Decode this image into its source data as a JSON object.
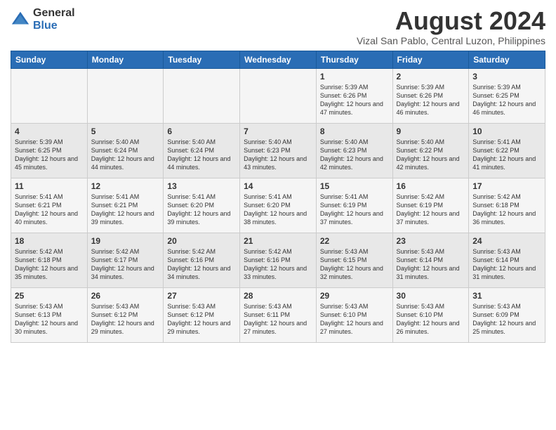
{
  "logo": {
    "general": "General",
    "blue": "Blue"
  },
  "title": {
    "month_year": "August 2024",
    "location": "Vizal San Pablo, Central Luzon, Philippines"
  },
  "days_of_week": [
    "Sunday",
    "Monday",
    "Tuesday",
    "Wednesday",
    "Thursday",
    "Friday",
    "Saturday"
  ],
  "weeks": [
    [
      {
        "day": "",
        "content": ""
      },
      {
        "day": "",
        "content": ""
      },
      {
        "day": "",
        "content": ""
      },
      {
        "day": "",
        "content": ""
      },
      {
        "day": "1",
        "content": "Sunrise: 5:39 AM\nSunset: 6:26 PM\nDaylight: 12 hours\nand 47 minutes."
      },
      {
        "day": "2",
        "content": "Sunrise: 5:39 AM\nSunset: 6:26 PM\nDaylight: 12 hours\nand 46 minutes."
      },
      {
        "day": "3",
        "content": "Sunrise: 5:39 AM\nSunset: 6:25 PM\nDaylight: 12 hours\nand 46 minutes."
      }
    ],
    [
      {
        "day": "4",
        "content": "Sunrise: 5:39 AM\nSunset: 6:25 PM\nDaylight: 12 hours\nand 45 minutes."
      },
      {
        "day": "5",
        "content": "Sunrise: 5:40 AM\nSunset: 6:24 PM\nDaylight: 12 hours\nand 44 minutes."
      },
      {
        "day": "6",
        "content": "Sunrise: 5:40 AM\nSunset: 6:24 PM\nDaylight: 12 hours\nand 44 minutes."
      },
      {
        "day": "7",
        "content": "Sunrise: 5:40 AM\nSunset: 6:23 PM\nDaylight: 12 hours\nand 43 minutes."
      },
      {
        "day": "8",
        "content": "Sunrise: 5:40 AM\nSunset: 6:23 PM\nDaylight: 12 hours\nand 42 minutes."
      },
      {
        "day": "9",
        "content": "Sunrise: 5:40 AM\nSunset: 6:22 PM\nDaylight: 12 hours\nand 42 minutes."
      },
      {
        "day": "10",
        "content": "Sunrise: 5:41 AM\nSunset: 6:22 PM\nDaylight: 12 hours\nand 41 minutes."
      }
    ],
    [
      {
        "day": "11",
        "content": "Sunrise: 5:41 AM\nSunset: 6:21 PM\nDaylight: 12 hours\nand 40 minutes."
      },
      {
        "day": "12",
        "content": "Sunrise: 5:41 AM\nSunset: 6:21 PM\nDaylight: 12 hours\nand 39 minutes."
      },
      {
        "day": "13",
        "content": "Sunrise: 5:41 AM\nSunset: 6:20 PM\nDaylight: 12 hours\nand 39 minutes."
      },
      {
        "day": "14",
        "content": "Sunrise: 5:41 AM\nSunset: 6:20 PM\nDaylight: 12 hours\nand 38 minutes."
      },
      {
        "day": "15",
        "content": "Sunrise: 5:41 AM\nSunset: 6:19 PM\nDaylight: 12 hours\nand 37 minutes."
      },
      {
        "day": "16",
        "content": "Sunrise: 5:42 AM\nSunset: 6:19 PM\nDaylight: 12 hours\nand 37 minutes."
      },
      {
        "day": "17",
        "content": "Sunrise: 5:42 AM\nSunset: 6:18 PM\nDaylight: 12 hours\nand 36 minutes."
      }
    ],
    [
      {
        "day": "18",
        "content": "Sunrise: 5:42 AM\nSunset: 6:18 PM\nDaylight: 12 hours\nand 35 minutes."
      },
      {
        "day": "19",
        "content": "Sunrise: 5:42 AM\nSunset: 6:17 PM\nDaylight: 12 hours\nand 34 minutes."
      },
      {
        "day": "20",
        "content": "Sunrise: 5:42 AM\nSunset: 6:16 PM\nDaylight: 12 hours\nand 34 minutes."
      },
      {
        "day": "21",
        "content": "Sunrise: 5:42 AM\nSunset: 6:16 PM\nDaylight: 12 hours\nand 33 minutes."
      },
      {
        "day": "22",
        "content": "Sunrise: 5:43 AM\nSunset: 6:15 PM\nDaylight: 12 hours\nand 32 minutes."
      },
      {
        "day": "23",
        "content": "Sunrise: 5:43 AM\nSunset: 6:14 PM\nDaylight: 12 hours\nand 31 minutes."
      },
      {
        "day": "24",
        "content": "Sunrise: 5:43 AM\nSunset: 6:14 PM\nDaylight: 12 hours\nand 31 minutes."
      }
    ],
    [
      {
        "day": "25",
        "content": "Sunrise: 5:43 AM\nSunset: 6:13 PM\nDaylight: 12 hours\nand 30 minutes."
      },
      {
        "day": "26",
        "content": "Sunrise: 5:43 AM\nSunset: 6:12 PM\nDaylight: 12 hours\nand 29 minutes."
      },
      {
        "day": "27",
        "content": "Sunrise: 5:43 AM\nSunset: 6:12 PM\nDaylight: 12 hours\nand 29 minutes."
      },
      {
        "day": "28",
        "content": "Sunrise: 5:43 AM\nSunset: 6:11 PM\nDaylight: 12 hours\nand 27 minutes."
      },
      {
        "day": "29",
        "content": "Sunrise: 5:43 AM\nSunset: 6:10 PM\nDaylight: 12 hours\nand 27 minutes."
      },
      {
        "day": "30",
        "content": "Sunrise: 5:43 AM\nSunset: 6:10 PM\nDaylight: 12 hours\nand 26 minutes."
      },
      {
        "day": "31",
        "content": "Sunrise: 5:43 AM\nSunset: 6:09 PM\nDaylight: 12 hours\nand 25 minutes."
      }
    ]
  ]
}
